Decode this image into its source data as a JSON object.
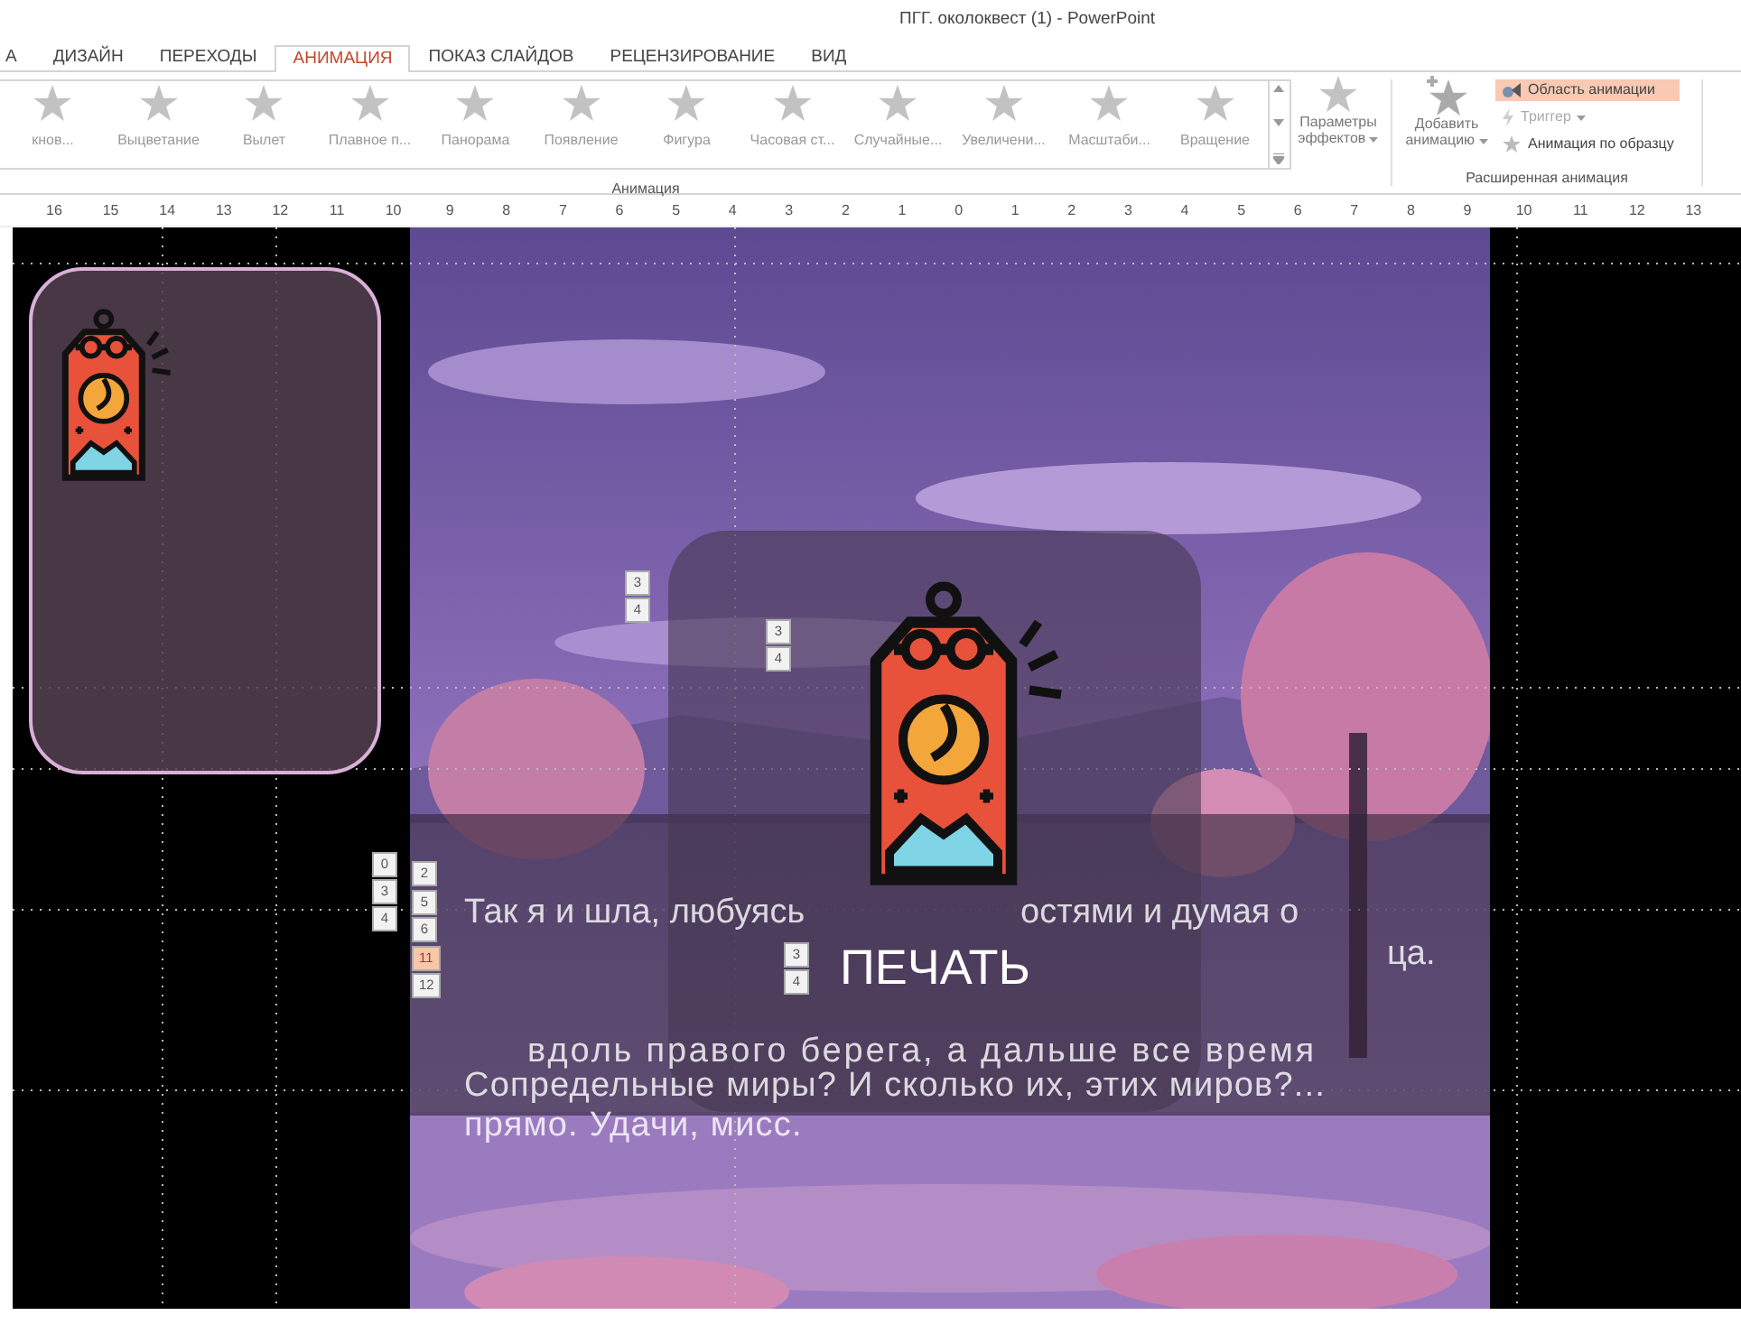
{
  "window": {
    "title": "ПГГ. околоквест (1) - PowerPoint"
  },
  "tabs": [
    {
      "label": "А",
      "selected": false
    },
    {
      "label": "ДИЗАЙН",
      "selected": false
    },
    {
      "label": "ПЕРЕХОДЫ",
      "selected": false
    },
    {
      "label": "АНИМАЦИЯ",
      "selected": true
    },
    {
      "label": "ПОКАЗ СЛАЙДОВ",
      "selected": false
    },
    {
      "label": "РЕЦЕНЗИРОВАНИЕ",
      "selected": false
    },
    {
      "label": "ВИД",
      "selected": false
    }
  ],
  "animation_gallery": {
    "effects": [
      {
        "label": "кнов..."
      },
      {
        "label": "Выцветание"
      },
      {
        "label": "Вылет"
      },
      {
        "label": "Плавное п..."
      },
      {
        "label": "Панорама"
      },
      {
        "label": "Появление"
      },
      {
        "label": "Фигура"
      },
      {
        "label": "Часовая ст..."
      },
      {
        "label": "Случайные..."
      },
      {
        "label": "Увеличени..."
      },
      {
        "label": "Масштаби..."
      },
      {
        "label": "Вращение"
      }
    ],
    "effect_options": "Параметры эффектов",
    "group_label": "Анимация"
  },
  "advanced_animation": {
    "add_animation": "Добавить анимацию",
    "commands": [
      {
        "label": "Область анимации",
        "selected": true,
        "disabled": false
      },
      {
        "label": "Триггер",
        "selected": false,
        "disabled": true
      },
      {
        "label": "Анимация по образцу",
        "selected": false,
        "disabled": false
      }
    ],
    "group_label": "Расширенная анимация"
  },
  "ruler": [
    "16",
    "15",
    "14",
    "13",
    "12",
    "11",
    "10",
    "9",
    "8",
    "7",
    "6",
    "5",
    "4",
    "3",
    "2",
    "1",
    "0",
    "1",
    "2",
    "3",
    "4",
    "5",
    "6",
    "7",
    "8",
    "9",
    "10",
    "11",
    "12",
    "13"
  ],
  "slide": {
    "tags": [
      {
        "text": "3",
        "selected": false
      },
      {
        "text": "4",
        "selected": false
      },
      {
        "text": "3",
        "selected": false
      },
      {
        "text": "4",
        "selected": false
      },
      {
        "text": "0",
        "selected": false
      },
      {
        "text": "3",
        "selected": false
      },
      {
        "text": "4",
        "selected": false
      },
      {
        "text": "2",
        "selected": false
      },
      {
        "text": "5",
        "selected": false
      },
      {
        "text": "6",
        "selected": false
      },
      {
        "text": "11",
        "selected": true
      },
      {
        "text": "12",
        "selected": false
      },
      {
        "text": "3",
        "selected": false
      },
      {
        "text": "4",
        "selected": false
      }
    ],
    "button_label": "ПЕЧАТЬ",
    "texts": [
      "Так я и шла, любуясь",
      "остями и думая о",
      "ца.",
      "вдоль правого берега, а дальше все время",
      "Сопредельные миры? И сколько их, этих миров?...",
      "прямо. Удачи, мисс."
    ]
  }
}
